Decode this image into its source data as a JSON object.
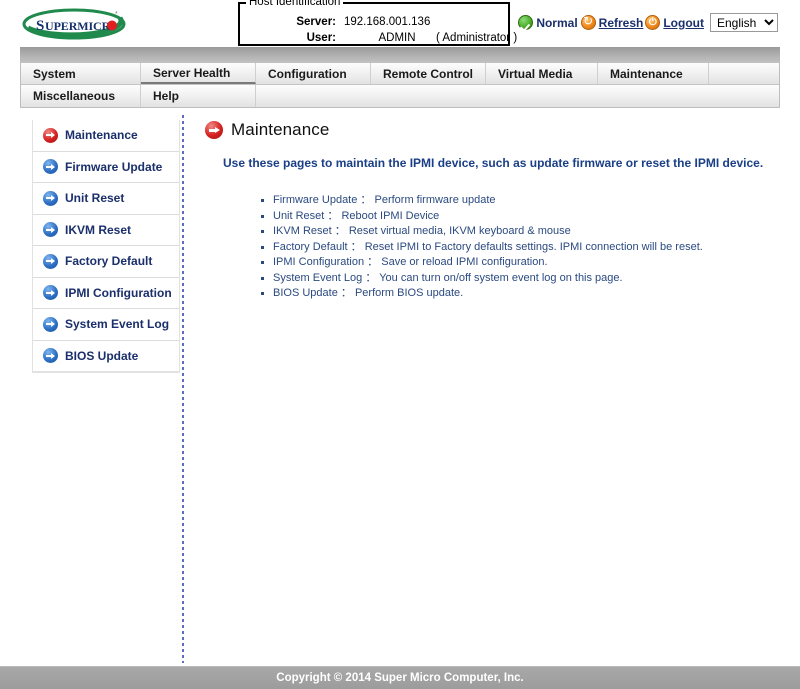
{
  "header": {
    "logo_text": "SUPERMICR",
    "logo_alt": "Supermicro",
    "host_identification": {
      "legend": "Host Identification",
      "server_label": "Server:",
      "server_value": "192.168.001.136",
      "user_label": "User:",
      "user_value": "ADMIN",
      "user_role": "( Administrator )"
    },
    "status": {
      "normal_label": "Normal",
      "refresh_label": "Refresh",
      "logout_label": "Logout",
      "language_selected": "English",
      "language_options": [
        "English"
      ]
    }
  },
  "menu": {
    "row1": [
      {
        "label": "System",
        "active": false
      },
      {
        "label": "Server Health",
        "active": true
      },
      {
        "label": "Configuration",
        "active": false
      },
      {
        "label": "Remote Control",
        "active": false
      },
      {
        "label": "Virtual Media",
        "active": false
      },
      {
        "label": "Maintenance",
        "active": false
      }
    ],
    "row2": [
      {
        "label": "Miscellaneous",
        "active": false
      },
      {
        "label": "Help",
        "active": false
      }
    ]
  },
  "sidebar": {
    "items": [
      {
        "label": "Maintenance",
        "state": "active",
        "color": "#d42020"
      },
      {
        "label": "Firmware Update",
        "state": "normal",
        "color": "#2e6fc4"
      },
      {
        "label": "Unit Reset",
        "state": "normal",
        "color": "#2e6fc4"
      },
      {
        "label": "IKVM Reset",
        "state": "normal",
        "color": "#2e6fc4"
      },
      {
        "label": "Factory Default",
        "state": "normal",
        "color": "#2e6fc4"
      },
      {
        "label": "IPMI Configuration",
        "state": "normal",
        "color": "#2e6fc4"
      },
      {
        "label": "System Event Log",
        "state": "normal",
        "color": "#2e6fc4"
      },
      {
        "label": "BIOS Update",
        "state": "normal",
        "color": "#2e6fc4"
      }
    ]
  },
  "main": {
    "title": "Maintenance",
    "intro": "Use these pages to maintain the IPMI device, such as update firmware or reset the IPMI device.",
    "features": [
      {
        "name": "Firmware Update",
        "sep": "：",
        "desc": "Perform firmware update"
      },
      {
        "name": "Unit Reset",
        "sep": "：",
        "desc": "Reboot IPMI Device"
      },
      {
        "name": "IKVM Reset",
        "sep": "：",
        "desc": "Reset virtual media, IKVM keyboard & mouse"
      },
      {
        "name": "Factory Default",
        "sep": "：",
        "desc": "Reset IPMI to Factory defaults settings. IPMI connection will be reset."
      },
      {
        "name": "IPMI Configuration",
        "sep": "：",
        "desc": "Save or reload IPMI configuration."
      },
      {
        "name": "System Event Log",
        "sep": "：",
        "desc": "You can turn on/off system event log on this page."
      },
      {
        "name": "BIOS Update",
        "sep": "：",
        "desc": "Perform BIOS update."
      }
    ]
  },
  "footer": {
    "copyright": "Copyright © 2014 Super Micro Computer, Inc."
  }
}
